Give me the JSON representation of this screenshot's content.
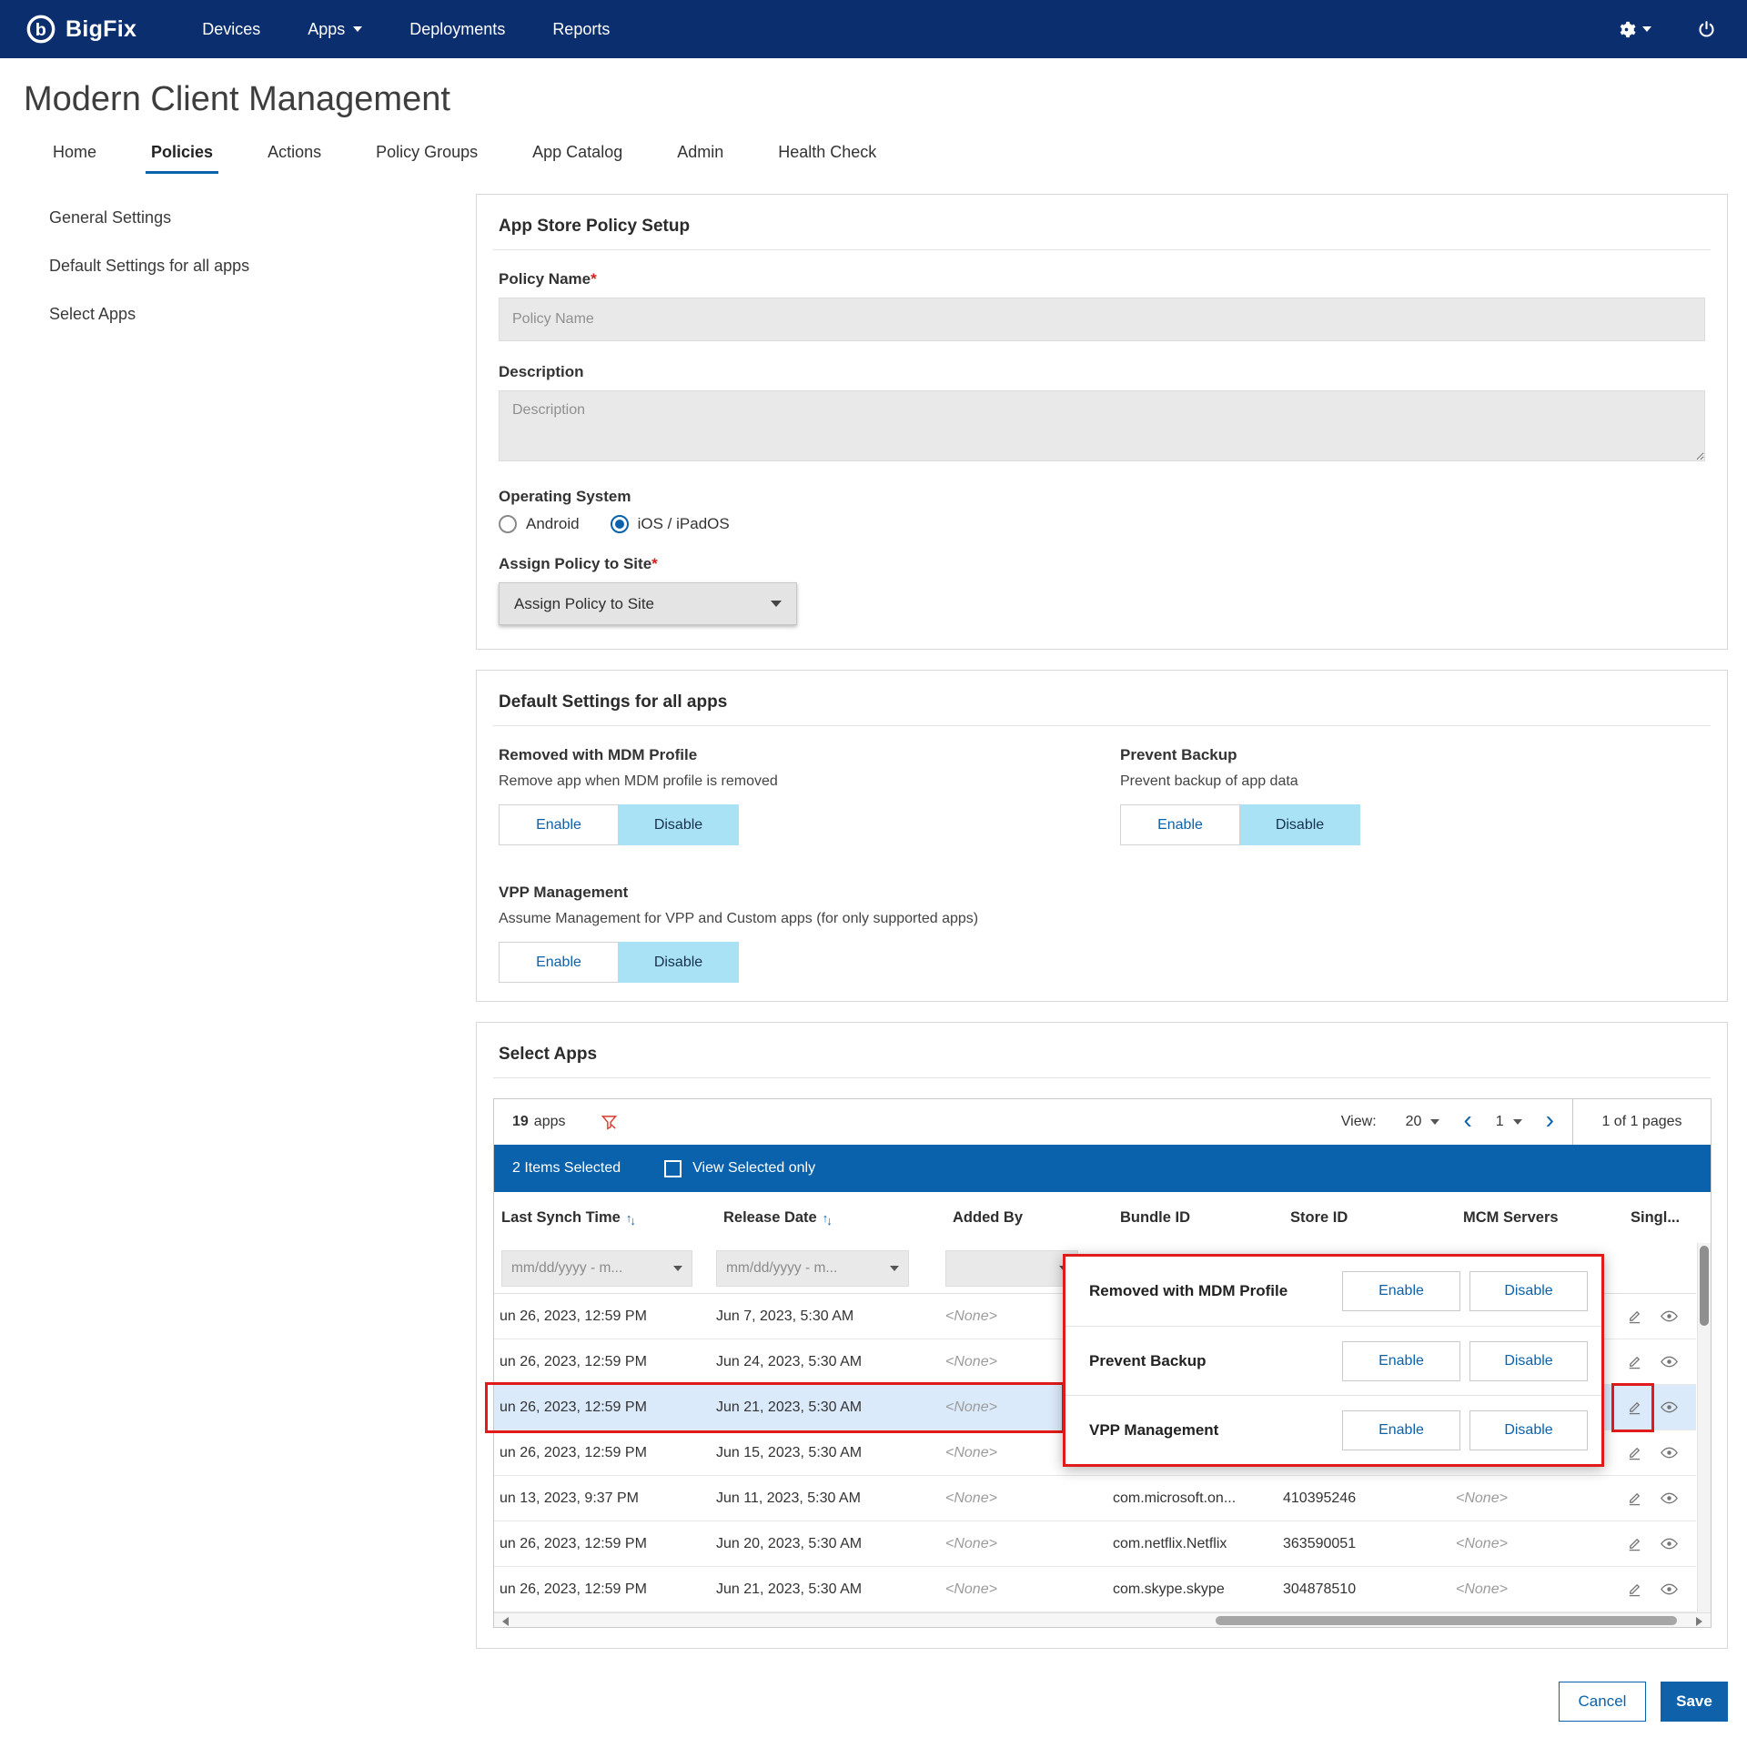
{
  "colors": {
    "topbar": "#0b2e6f",
    "accent": "#0a62ad",
    "toggle_active": "#a9e1f5",
    "annotation_red": "#e11b1b",
    "row_highlight": "#dbeafb"
  },
  "topbar": {
    "brand": "BigFix",
    "nav": [
      {
        "label": "Devices"
      },
      {
        "label": "Apps"
      },
      {
        "label": "Deployments"
      },
      {
        "label": "Reports"
      }
    ]
  },
  "page": {
    "title": "Modern Client Management"
  },
  "tabs": [
    {
      "label": "Home"
    },
    {
      "label": "Policies"
    },
    {
      "label": "Actions"
    },
    {
      "label": "Policy Groups"
    },
    {
      "label": "App Catalog"
    },
    {
      "label": "Admin"
    },
    {
      "label": "Health Check"
    }
  ],
  "sidebar": {
    "items": [
      {
        "label": "General Settings"
      },
      {
        "label": "Default Settings for all apps"
      },
      {
        "label": "Select Apps"
      }
    ]
  },
  "policy_setup": {
    "title": "App Store Policy Setup",
    "fields": {
      "policy_name": {
        "label": "Policy Name",
        "required": "*",
        "placeholder": "Policy Name",
        "value": ""
      },
      "description": {
        "label": "Description",
        "placeholder": "Description",
        "value": ""
      },
      "os": {
        "label": "Operating System",
        "options": [
          {
            "label": "Android",
            "selected": false
          },
          {
            "label": "iOS / iPadOS",
            "selected": true
          }
        ]
      },
      "assign_site": {
        "label": "Assign Policy to Site",
        "required": "*",
        "selected_value": "Assign Policy to Site"
      }
    }
  },
  "default_settings": {
    "title": "Default Settings for all apps",
    "enable_label": "Enable",
    "disable_label": "Disable",
    "settings": [
      {
        "name": "Removed with MDM Profile",
        "description": "Remove app when MDM profile is removed",
        "state": "Disable"
      },
      {
        "name": "Prevent Backup",
        "description": "Prevent backup of app data",
        "state": "Disable"
      },
      {
        "name": "VPP Management",
        "description": "Assume Management for VPP and Custom apps (for only supported apps)",
        "state": "Disable"
      }
    ]
  },
  "select_apps": {
    "title": "Select Apps",
    "toolbar": {
      "count": "19",
      "count_label": "apps",
      "view_label": "View:",
      "page_size": "20",
      "current_page": "1",
      "pages_text": "1 of 1 pages"
    },
    "selection_bar": {
      "selected_text": "2 Items Selected",
      "view_selected_label": "View Selected only"
    },
    "columns": [
      "Last Synch Time",
      "Release Date",
      "Added By",
      "Bundle ID",
      "Store ID",
      "MCM Servers",
      "Singl..."
    ],
    "filter_row": {
      "date_placeholder": "mm/dd/yyyy - m..."
    },
    "rows": [
      {
        "last_synch": "un 26, 2023, 12:59 PM",
        "release_date": "Jun 7, 2023, 5:30 AM",
        "added_by": "<None>",
        "bundle_id": "",
        "store_id": "",
        "mcm_servers": ""
      },
      {
        "last_synch": "un 26, 2023, 12:59 PM",
        "release_date": "Jun 24, 2023, 5:30 AM",
        "added_by": "<None>",
        "bundle_id": "",
        "store_id": "",
        "mcm_servers": ""
      },
      {
        "last_synch": "un 26, 2023, 12:59 PM",
        "release_date": "Jun 21, 2023, 5:30 AM",
        "added_by": "<None>",
        "bundle_id": "",
        "store_id": "",
        "mcm_servers": "",
        "highlighted": true
      },
      {
        "last_synch": "un 26, 2023, 12:59 PM",
        "release_date": "Jun 15, 2023, 5:30 AM",
        "added_by": "<None>",
        "bundle_id": "",
        "store_id": "",
        "mcm_servers": ""
      },
      {
        "last_synch": "un 13, 2023, 9:37 PM",
        "release_date": "Jun 11, 2023, 5:30 AM",
        "added_by": "<None>",
        "bundle_id": "com.microsoft.on...",
        "store_id": "410395246",
        "mcm_servers": "<None>"
      },
      {
        "last_synch": "un 26, 2023, 12:59 PM",
        "release_date": "Jun 20, 2023, 5:30 AM",
        "added_by": "<None>",
        "bundle_id": "com.netflix.Netflix",
        "store_id": "363590051",
        "mcm_servers": "<None>"
      },
      {
        "last_synch": "un 26, 2023, 12:59 PM",
        "release_date": "Jun 21, 2023, 5:30 AM",
        "added_by": "<None>",
        "bundle_id": "com.skype.skype",
        "store_id": "304878510",
        "mcm_servers": "<None>"
      }
    ],
    "popup": {
      "enable_label": "Enable",
      "disable_label": "Disable",
      "settings": [
        "Removed with MDM Profile",
        "Prevent Backup",
        "VPP Management"
      ]
    }
  },
  "footer": {
    "cancel_label": "Cancel",
    "save_label": "Save"
  }
}
